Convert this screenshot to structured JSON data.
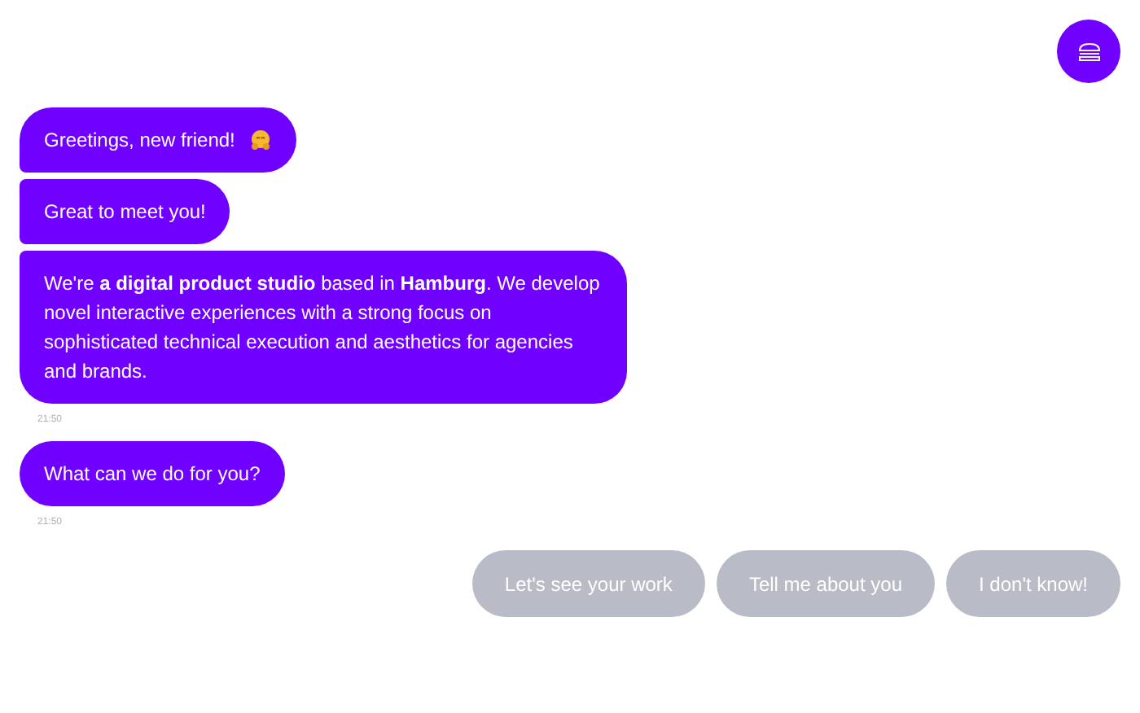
{
  "menu_button": {
    "kind": "burger"
  },
  "groups": [
    {
      "messages": [
        {
          "text": "Greetings, new friend!",
          "emoji": true
        },
        {
          "text": "Great to meet you!",
          "emoji": false
        },
        {
          "text": "We're **a digital product studio** based in **Hamburg**. We develop novel interactive experiences with a strong focus on sophisticated technical execution and aesthetics for agencies and brands.",
          "emoji": false
        }
      ],
      "time": "21:50"
    },
    {
      "messages": [
        {
          "text": "What can we do for you?",
          "emoji": false
        }
      ],
      "time": "21:50"
    }
  ],
  "replies": [
    "Let's see your work",
    "Tell me about you",
    "I don't know!"
  ]
}
